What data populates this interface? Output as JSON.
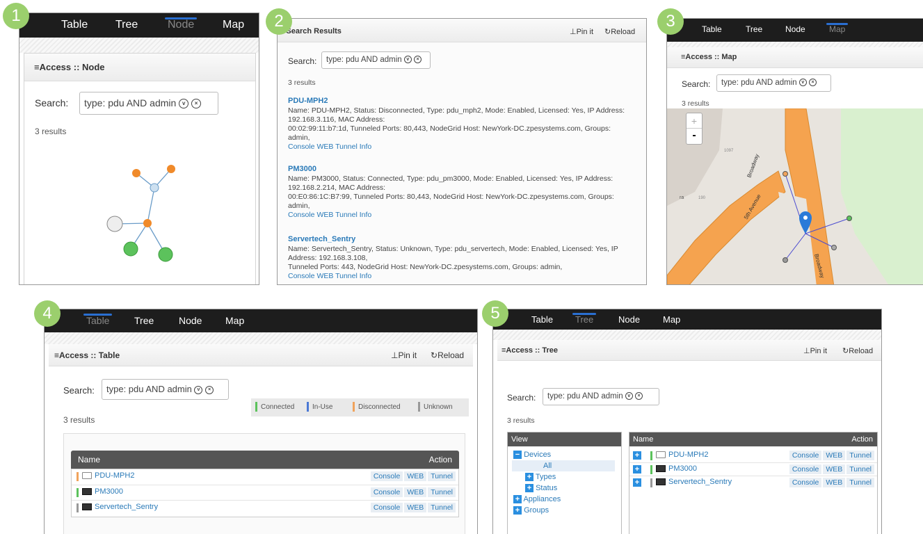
{
  "badges": [
    "1",
    "2",
    "3",
    "4",
    "5"
  ],
  "nav": {
    "table": "Table",
    "tree": "Tree",
    "node": "Node",
    "map": "Map"
  },
  "search": {
    "label": "Search:",
    "query": "type: pdu AND admin",
    "results": "3 results"
  },
  "header": {
    "node": "Access :: Node",
    "results": "Search Results",
    "map": "Access :: Map",
    "table": "Access :: Table",
    "tree": "Access :: Tree",
    "pin": "Pin it",
    "reload": "Reload"
  },
  "devices": [
    {
      "name": "PDU-MPH2",
      "desc_lines": [
        "Name: PDU-MPH2, Status: Disconnected, Type: pdu_mph2, Mode: Enabled, Licensed: Yes, IP Address:",
        "192.168.3.116, MAC Address:",
        "00:02:99:11:b7:1d, Tunneled Ports: 80,443, NodeGrid Host: NewYork-DC.zpesystems.com, Groups:",
        "admin,"
      ],
      "status_color": "#f0a35c",
      "icon": "monitor-icon"
    },
    {
      "name": "PM3000",
      "desc_lines": [
        "Name: PM3000, Status: Connected, Type: pdu_pm3000, Mode: Enabled, Licensed: Yes, IP Address:",
        "192.168.2.214, MAC Address:",
        "00:E0:86:1C:B7:99, Tunneled Ports: 80,443, NodeGrid Host: NewYork-DC.zpesystems.com, Groups:",
        "admin,"
      ],
      "status_color": "#5cc25c",
      "icon": "pdu-icon"
    },
    {
      "name": "Servertech_Sentry",
      "desc_lines": [
        "Name: Servertech_Sentry, Status: Unknown, Type: pdu_servertech, Mode: Enabled, Licensed: Yes, IP",
        "Address: 192.168.3.108,",
        "Tunneled Ports: 443, NodeGrid Host: NewYork-DC.zpesystems.com, Groups: admin,"
      ],
      "status_color": "#999999",
      "icon": "pdu-icon"
    }
  ],
  "links": {
    "console_web_tunnel_info": "Console WEB Tunnel Info"
  },
  "actions": {
    "console": "Console",
    "web": "WEB",
    "tunnel": "Tunnel"
  },
  "grid": {
    "name": "Name",
    "action": "Action",
    "view": "View"
  },
  "legend": [
    {
      "label": "Connected",
      "color": "#5cc25c"
    },
    {
      "label": "In-Use",
      "color": "#4a78d4"
    },
    {
      "label": "Disconnected",
      "color": "#f0a35c"
    },
    {
      "label": "Unknown",
      "color": "#999999"
    }
  ],
  "tree_view": [
    "Devices",
    "All",
    "Types",
    "Status",
    "Appliances",
    "Groups"
  ],
  "map": {
    "zoom_in": "+",
    "zoom_out": "-",
    "labels": [
      "Broadway",
      "5th Avenue",
      "Broadway",
      "1097",
      "190",
      "ra"
    ]
  }
}
